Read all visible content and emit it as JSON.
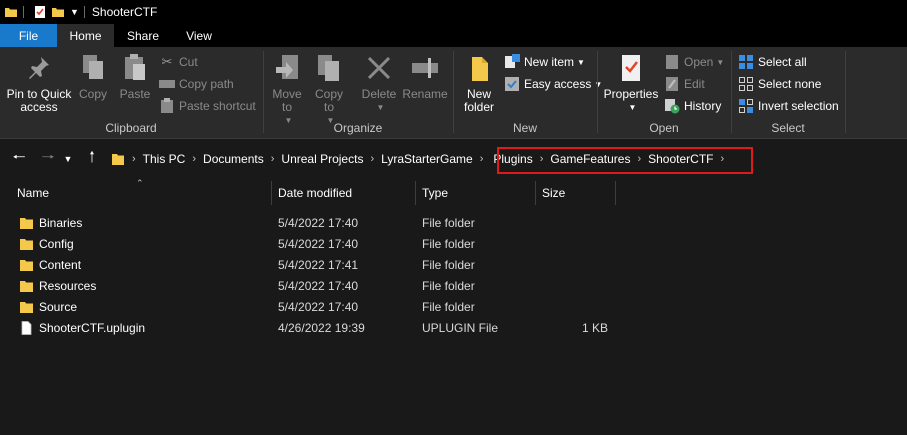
{
  "window": {
    "title": "ShooterCTF"
  },
  "tabs": [
    {
      "label": "File"
    },
    {
      "label": "Home"
    },
    {
      "label": "Share"
    },
    {
      "label": "View"
    }
  ],
  "ribbon": {
    "clipboard": {
      "label": "Clipboard",
      "pin_label_1": "Pin to Quick",
      "pin_label_2": "access",
      "copy": "Copy",
      "paste": "Paste",
      "cut": "Cut",
      "copy_path": "Copy path",
      "paste_shortcut": "Paste shortcut"
    },
    "organize": {
      "label": "Organize",
      "move_to_1": "Move",
      "move_to_2": "to",
      "copy_to_1": "Copy",
      "copy_to_2": "to",
      "delete": "Delete",
      "rename": "Rename"
    },
    "new": {
      "label": "New",
      "new_folder_1": "New",
      "new_folder_2": "folder",
      "new_item": "New item",
      "easy_access": "Easy access"
    },
    "open": {
      "label": "Open",
      "properties": "Properties",
      "open": "Open",
      "edit": "Edit",
      "history": "History"
    },
    "select": {
      "label": "Select",
      "select_all": "Select all",
      "select_none": "Select none",
      "invert_selection": "Invert selection"
    }
  },
  "address": {
    "crumbs": [
      "This PC",
      "Documents",
      "Unreal Projects",
      "LyraStarterGame",
      "Plugins",
      "GameFeatures",
      "ShooterCTF"
    ],
    "highlight_color": "#e01a1a"
  },
  "columns": {
    "name": "Name",
    "date": "Date modified",
    "type": "Type",
    "size": "Size"
  },
  "files": [
    {
      "name": "Binaries",
      "date": "5/4/2022 17:40",
      "type": "File folder",
      "size": "",
      "icon": "folder-icon"
    },
    {
      "name": "Config",
      "date": "5/4/2022 17:40",
      "type": "File folder",
      "size": "",
      "icon": "folder-icon"
    },
    {
      "name": "Content",
      "date": "5/4/2022 17:41",
      "type": "File folder",
      "size": "",
      "icon": "folder-icon"
    },
    {
      "name": "Resources",
      "date": "5/4/2022 17:40",
      "type": "File folder",
      "size": "",
      "icon": "folder-icon"
    },
    {
      "name": "Source",
      "date": "5/4/2022 17:40",
      "type": "File folder",
      "size": "",
      "icon": "folder-icon"
    },
    {
      "name": "ShooterCTF.uplugin",
      "date": "4/26/2022 19:39",
      "type": "UPLUGIN File",
      "size": "1 KB",
      "icon": "file-icon"
    }
  ],
  "colors": {
    "accent": "#1979ca",
    "folder": "#f4c84a",
    "background": "#191919",
    "ribbon": "#2b2b2b"
  }
}
